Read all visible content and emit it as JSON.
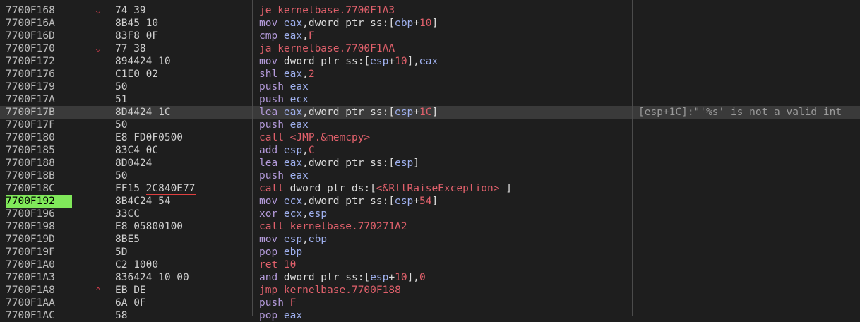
{
  "title": "",
  "current_address": "7700F192",
  "selected_row": 8,
  "colors": {
    "background": "#1e1e1e",
    "selected_row": "#3a3a3a",
    "current_ip_highlight": "#80e85a",
    "jump_arrow": "#e04050"
  },
  "rows": [
    {
      "addr": "7700F168",
      "arrow": "down",
      "bytes": "74 39",
      "dis": [
        [
          "je",
          "kw-r"
        ],
        [
          " kernelbase.7700F1A3",
          "kw-r"
        ]
      ],
      "comment": ""
    },
    {
      "addr": "7700F16A",
      "arrow": "",
      "bytes": "8B45 10",
      "dis": [
        [
          "mov",
          "kw-b"
        ],
        [
          " eax",
          "tok-reg"
        ],
        [
          ",dword ptr ",
          "tok-w"
        ],
        [
          "ss",
          "tok-seg"
        ],
        [
          ":[",
          "tok-w"
        ],
        [
          "ebp",
          "tok-reg"
        ],
        [
          "+",
          "tok-w"
        ],
        [
          "10",
          "tok-num"
        ],
        [
          "]",
          "tok-w"
        ]
      ],
      "comment": ""
    },
    {
      "addr": "7700F16D",
      "arrow": "",
      "bytes": "83F8 0F",
      "dis": [
        [
          "cmp",
          "kw-b"
        ],
        [
          " eax",
          "tok-reg"
        ],
        [
          ",",
          "tok-w"
        ],
        [
          "F",
          "tok-num"
        ]
      ],
      "comment": ""
    },
    {
      "addr": "7700F170",
      "arrow": "down",
      "bytes": "77 38",
      "dis": [
        [
          "ja",
          "kw-r"
        ],
        [
          " kernelbase.7700F1AA",
          "kw-r"
        ]
      ],
      "comment": ""
    },
    {
      "addr": "7700F172",
      "arrow": "",
      "bytes": "894424 10",
      "dis": [
        [
          "mov",
          "kw-b"
        ],
        [
          " dword ptr ",
          "tok-w"
        ],
        [
          "ss",
          "tok-seg"
        ],
        [
          ":[",
          "tok-w"
        ],
        [
          "esp",
          "tok-reg"
        ],
        [
          "+",
          "tok-w"
        ],
        [
          "10",
          "tok-num"
        ],
        [
          "],",
          "tok-w"
        ],
        [
          "eax",
          "tok-reg"
        ]
      ],
      "comment": ""
    },
    {
      "addr": "7700F176",
      "arrow": "",
      "bytes": "C1E0 02",
      "dis": [
        [
          "shl",
          "kw-b"
        ],
        [
          " eax",
          "tok-reg"
        ],
        [
          ",",
          "tok-w"
        ],
        [
          "2",
          "tok-num"
        ]
      ],
      "comment": ""
    },
    {
      "addr": "7700F179",
      "arrow": "",
      "bytes": "50",
      "dis": [
        [
          "push",
          "kw-b"
        ],
        [
          " eax",
          "tok-reg"
        ]
      ],
      "comment": ""
    },
    {
      "addr": "7700F17A",
      "arrow": "",
      "bytes": "51",
      "dis": [
        [
          "push",
          "kw-b"
        ],
        [
          " ecx",
          "tok-reg"
        ]
      ],
      "comment": ""
    },
    {
      "addr": "7700F17B",
      "arrow": "",
      "bytes": "8D4424 1C",
      "dis": [
        [
          "lea",
          "kw-b"
        ],
        [
          " eax",
          "tok-reg"
        ],
        [
          ",dword ptr ",
          "tok-w"
        ],
        [
          "ss",
          "tok-seg"
        ],
        [
          ":[",
          "tok-w"
        ],
        [
          "esp",
          "tok-reg"
        ],
        [
          "+",
          "tok-w"
        ],
        [
          "1C",
          "tok-num"
        ],
        [
          "]",
          "tok-w"
        ]
      ],
      "comment": "[esp+1C]:\"'%s' is not a valid int"
    },
    {
      "addr": "7700F17F",
      "arrow": "",
      "bytes": "50",
      "dis": [
        [
          "push",
          "kw-b"
        ],
        [
          " eax",
          "tok-reg"
        ]
      ],
      "comment": ""
    },
    {
      "addr": "7700F180",
      "arrow": "",
      "bytes": "E8 FD0F0500",
      "dis": [
        [
          "call",
          "kw-r"
        ],
        [
          " <JMP.&memcpy>",
          "kw-r"
        ]
      ],
      "comment": ""
    },
    {
      "addr": "7700F185",
      "arrow": "",
      "bytes": "83C4 0C",
      "dis": [
        [
          "add",
          "kw-b"
        ],
        [
          " esp",
          "tok-reg"
        ],
        [
          ",",
          "tok-w"
        ],
        [
          "C",
          "tok-num"
        ]
      ],
      "comment": ""
    },
    {
      "addr": "7700F188",
      "arrow": "",
      "bytes": "8D0424",
      "dis": [
        [
          "lea",
          "kw-b"
        ],
        [
          " eax",
          "tok-reg"
        ],
        [
          ",dword ptr ",
          "tok-w"
        ],
        [
          "ss",
          "tok-seg"
        ],
        [
          ":[",
          "tok-w"
        ],
        [
          "esp",
          "tok-reg"
        ],
        [
          "]",
          "tok-w"
        ]
      ],
      "comment": ""
    },
    {
      "addr": "7700F18B",
      "arrow": "",
      "bytes": "50",
      "dis": [
        [
          "push",
          "kw-b"
        ],
        [
          " eax",
          "tok-reg"
        ]
      ],
      "comment": ""
    },
    {
      "addr": "7700F18C",
      "arrow": "",
      "bytes": "FF15 ",
      "bytes_u": "2C840E77",
      "dis": [
        [
          "call",
          "kw-r"
        ],
        [
          " dword ptr ",
          "tok-w"
        ],
        [
          "ds",
          "tok-seg"
        ],
        [
          ":[",
          "tok-w"
        ],
        [
          "<&RtlRaiseException>",
          "kw-r"
        ],
        [
          " ]",
          "tok-w"
        ]
      ],
      "comment": ""
    },
    {
      "addr": "7700F192",
      "arrow": "",
      "bytes": "8B4C24 54",
      "dis": [
        [
          "mov",
          "kw-b"
        ],
        [
          " ecx",
          "tok-reg"
        ],
        [
          ",dword ptr ",
          "tok-w"
        ],
        [
          "ss",
          "tok-seg"
        ],
        [
          ":[",
          "tok-w"
        ],
        [
          "esp",
          "tok-reg"
        ],
        [
          "+",
          "tok-w"
        ],
        [
          "54",
          "tok-num"
        ],
        [
          "]",
          "tok-w"
        ]
      ],
      "comment": "",
      "current": true
    },
    {
      "addr": "7700F196",
      "arrow": "",
      "bytes": "33CC",
      "dis": [
        [
          "xor",
          "kw-b"
        ],
        [
          " ecx",
          "tok-reg"
        ],
        [
          ",",
          "tok-w"
        ],
        [
          "esp",
          "tok-reg"
        ]
      ],
      "comment": ""
    },
    {
      "addr": "7700F198",
      "arrow": "",
      "bytes": "E8 05800100",
      "dis": [
        [
          "call",
          "kw-r"
        ],
        [
          " kernelbase.770271A2",
          "kw-r"
        ]
      ],
      "comment": ""
    },
    {
      "addr": "7700F19D",
      "arrow": "",
      "bytes": "8BE5",
      "dis": [
        [
          "mov",
          "kw-b"
        ],
        [
          " esp",
          "tok-reg"
        ],
        [
          ",",
          "tok-w"
        ],
        [
          "ebp",
          "tok-reg"
        ]
      ],
      "comment": ""
    },
    {
      "addr": "7700F19F",
      "arrow": "",
      "bytes": "5D",
      "dis": [
        [
          "pop",
          "kw-b"
        ],
        [
          " ebp",
          "tok-reg"
        ]
      ],
      "comment": ""
    },
    {
      "addr": "7700F1A0",
      "arrow": "",
      "bytes": "C2 1000",
      "dis": [
        [
          "ret",
          "kw-r"
        ],
        [
          " 10",
          "tok-num"
        ]
      ],
      "comment": ""
    },
    {
      "addr": "7700F1A3",
      "arrow": "",
      "bytes": "836424 10 00",
      "dis": [
        [
          "and",
          "kw-b"
        ],
        [
          " dword ptr ",
          "tok-w"
        ],
        [
          "ss",
          "tok-seg"
        ],
        [
          ":[",
          "tok-w"
        ],
        [
          "esp",
          "tok-reg"
        ],
        [
          "+",
          "tok-w"
        ],
        [
          "10",
          "tok-num"
        ],
        [
          "],",
          "tok-w"
        ],
        [
          "0",
          "tok-num"
        ]
      ],
      "comment": ""
    },
    {
      "addr": "7700F1A8",
      "arrow": "up",
      "bytes": "EB DE",
      "dis": [
        [
          "jmp",
          "kw-r"
        ],
        [
          " kernelbase.7700F188",
          "kw-r"
        ]
      ],
      "comment": ""
    },
    {
      "addr": "7700F1AA",
      "arrow": "",
      "bytes": "6A 0F",
      "dis": [
        [
          "push",
          "kw-b"
        ],
        [
          " F",
          "tok-num"
        ]
      ],
      "comment": ""
    },
    {
      "addr": "7700F1AC",
      "arrow": "",
      "bytes": "58",
      "dis": [
        [
          "pop",
          "kw-b"
        ],
        [
          " eax",
          "tok-reg"
        ]
      ],
      "comment": ""
    }
  ]
}
